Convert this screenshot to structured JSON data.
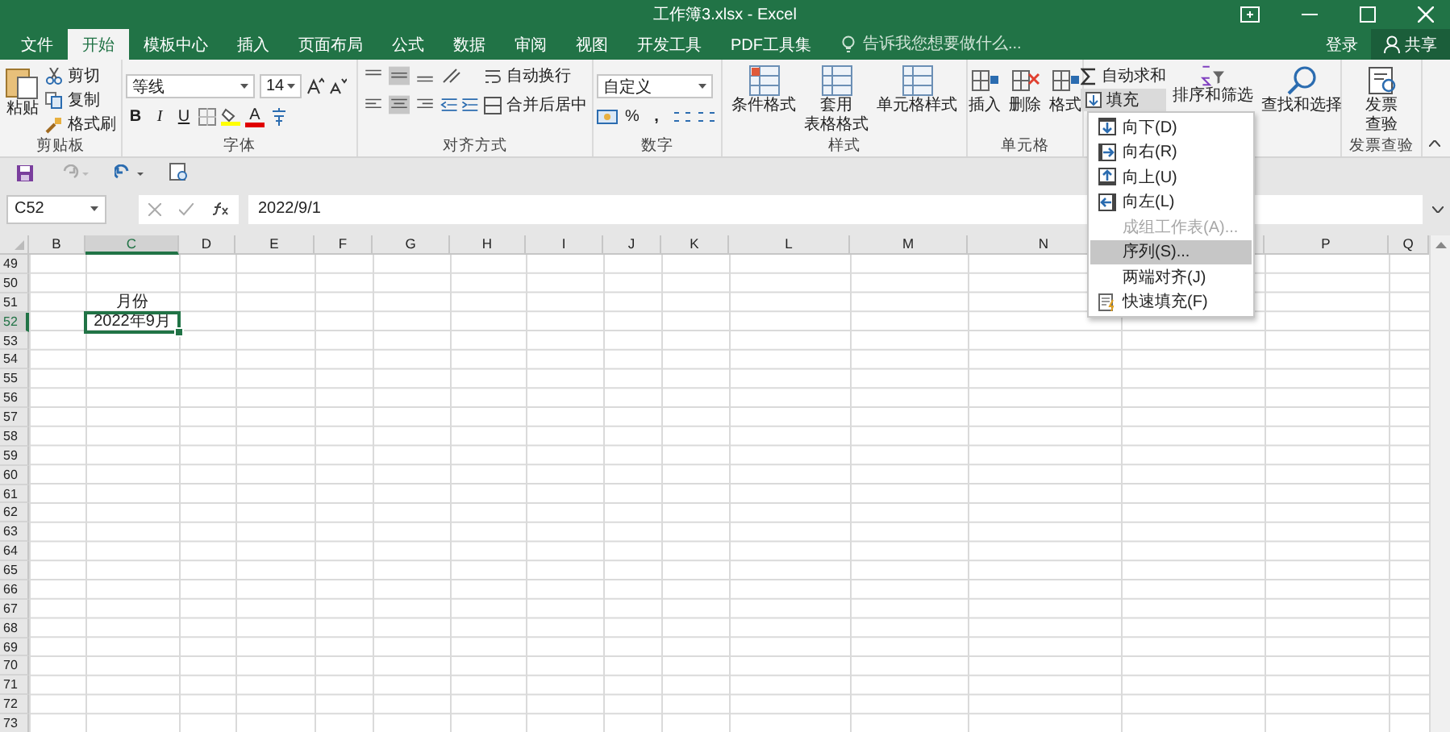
{
  "window": {
    "title": "工作簿3.xlsx - Excel"
  },
  "tabs": [
    {
      "label": "文件",
      "selected": false
    },
    {
      "label": "开始",
      "selected": true
    },
    {
      "label": "模板中心",
      "selected": false
    },
    {
      "label": "插入",
      "selected": false
    },
    {
      "label": "页面布局",
      "selected": false
    },
    {
      "label": "公式",
      "selected": false
    },
    {
      "label": "数据",
      "selected": false
    },
    {
      "label": "审阅",
      "selected": false
    },
    {
      "label": "视图",
      "selected": false
    },
    {
      "label": "开发工具",
      "selected": false
    },
    {
      "label": "PDF工具集",
      "selected": false
    }
  ],
  "tell_me": {
    "placeholder": "告诉我您想要做什么..."
  },
  "account": {
    "login": "登录",
    "share": "共享"
  },
  "ribbon": {
    "clipboard": {
      "label": "剪贴板",
      "paste": "粘贴",
      "cut": "剪切",
      "copy": "复制",
      "format_painter": "格式刷"
    },
    "font": {
      "label": "字体",
      "font_name": "等线",
      "font_size": "14",
      "bold": "B",
      "italic": "I",
      "underline": "U",
      "font_color": "A"
    },
    "alignment": {
      "label": "对齐方式",
      "wrap_text": "自动换行",
      "merge_center": "合并后居中"
    },
    "number": {
      "label": "数字",
      "format": "自定义",
      "percent": "%",
      "comma": ","
    },
    "styles": {
      "label": "样式",
      "buttons": [
        {
          "lines": [
            "条件格式"
          ]
        },
        {
          "lines": [
            "套用",
            "表格格式"
          ]
        },
        {
          "lines": [
            "单元格样式"
          ]
        }
      ]
    },
    "cells": {
      "label": "单元格",
      "buttons": [
        {
          "lines": [
            "插入"
          ]
        },
        {
          "lines": [
            "删除"
          ]
        },
        {
          "lines": [
            "格式"
          ]
        }
      ]
    },
    "editing": {
      "autosum": "自动求和",
      "fill": "填充",
      "sort_filter": "排序和筛选",
      "find_select": "查找和选择"
    },
    "invoice": {
      "label": "发票查验",
      "button": [
        "发票",
        "查验"
      ]
    }
  },
  "fill_menu": [
    {
      "label": "向下(D)",
      "kind": "down",
      "disabled": false,
      "selected": false
    },
    {
      "label": "向右(R)",
      "kind": "right",
      "disabled": false,
      "selected": false
    },
    {
      "label": "向上(U)",
      "kind": "up",
      "disabled": false,
      "selected": false
    },
    {
      "label": "向左(L)",
      "kind": "left",
      "disabled": false,
      "selected": false
    },
    {
      "label": "成组工作表(A)...",
      "kind": "plain",
      "disabled": true,
      "selected": false
    },
    {
      "label": "序列(S)...",
      "kind": "plain",
      "disabled": false,
      "selected": true
    },
    {
      "label": "两端对齐(J)",
      "kind": "plain",
      "disabled": false,
      "selected": false
    },
    {
      "label": "快速填充(F)",
      "kind": "flash",
      "disabled": false,
      "selected": false
    }
  ],
  "formula_bar": {
    "name_box": "C52",
    "formula": "2022/9/1"
  },
  "columns": [
    {
      "label": "B",
      "selected": false
    },
    {
      "label": "C",
      "selected": true
    },
    {
      "label": "D",
      "selected": false
    },
    {
      "label": "E",
      "selected": false
    },
    {
      "label": "F",
      "selected": false
    },
    {
      "label": "G",
      "selected": false
    },
    {
      "label": "H",
      "selected": false
    },
    {
      "label": "I",
      "selected": false
    },
    {
      "label": "J",
      "selected": false
    },
    {
      "label": "K",
      "selected": false
    },
    {
      "label": "L",
      "selected": false
    },
    {
      "label": "M",
      "selected": false
    },
    {
      "label": "N",
      "selected": false
    },
    {
      "selected": false
    },
    {
      "label": "P",
      "selected": false
    },
    {
      "label": "Q",
      "selected": false
    }
  ],
  "rows": [
    {
      "label": "49",
      "selected": false
    },
    {
      "label": "50",
      "selected": false
    },
    {
      "label": "51",
      "selected": false,
      "column_c": {
        "text": "月份",
        "active": false
      }
    },
    {
      "label": "52",
      "selected": true,
      "column_c": {
        "text": "2022年9月",
        "active": true
      }
    },
    {
      "label": "53",
      "selected": false
    },
    {
      "label": "54",
      "selected": false
    },
    {
      "label": "55",
      "selected": false
    },
    {
      "label": "56",
      "selected": false
    },
    {
      "label": "57",
      "selected": false
    },
    {
      "label": "58",
      "selected": false
    },
    {
      "label": "59",
      "selected": false
    },
    {
      "label": "60",
      "selected": false
    },
    {
      "label": "61",
      "selected": false
    },
    {
      "label": "62",
      "selected": false
    },
    {
      "label": "63",
      "selected": false
    },
    {
      "label": "64",
      "selected": false
    },
    {
      "label": "65",
      "selected": false
    },
    {
      "label": "66",
      "selected": false
    },
    {
      "label": "67",
      "selected": false
    },
    {
      "label": "68",
      "selected": false
    },
    {
      "label": "69",
      "selected": false
    },
    {
      "label": "70",
      "selected": false
    },
    {
      "label": "71",
      "selected": false
    },
    {
      "label": "72",
      "selected": false
    },
    {
      "label": "73",
      "selected": false
    }
  ]
}
